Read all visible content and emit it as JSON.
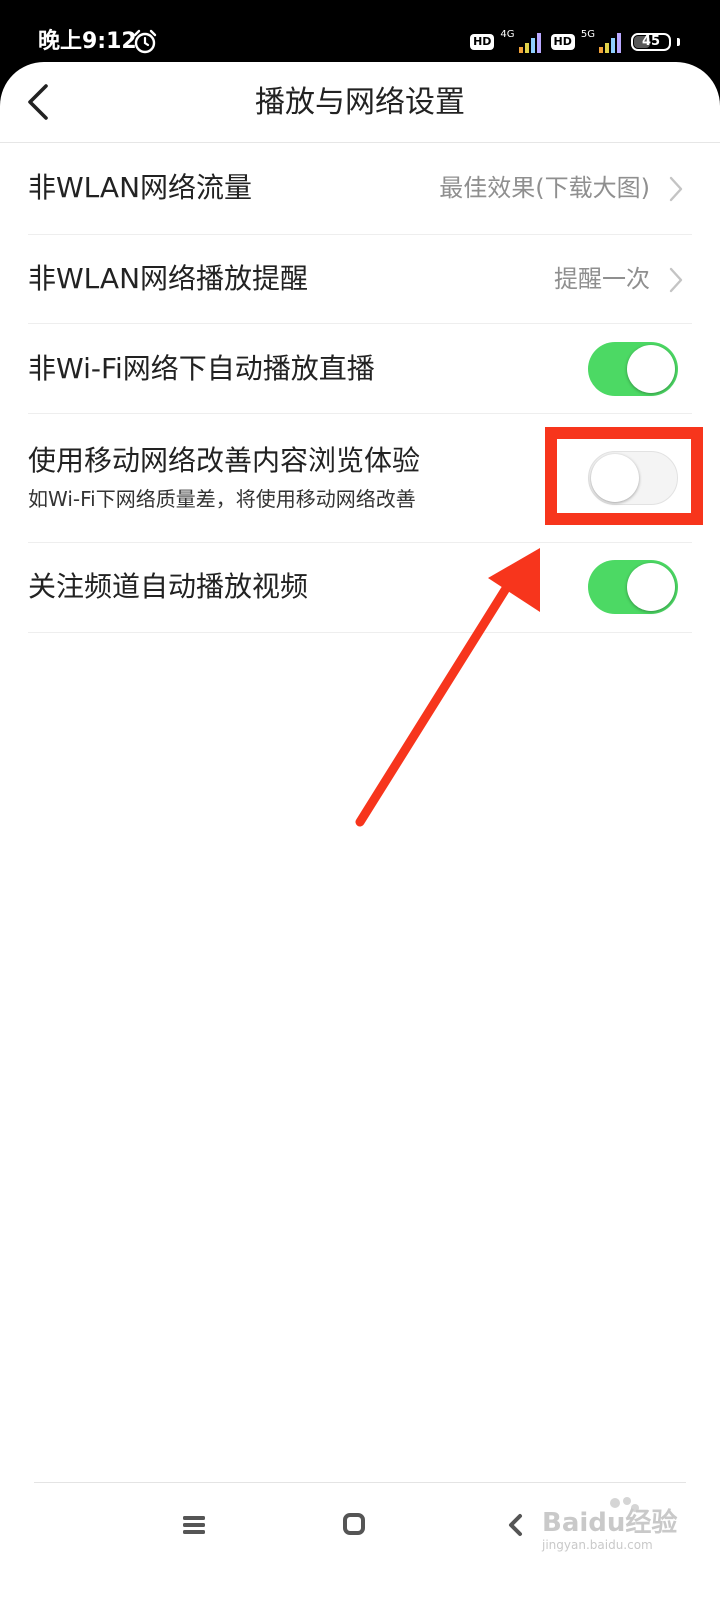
{
  "status_bar": {
    "time": "晚上9:12",
    "hd_badges": [
      "HD",
      "HD"
    ],
    "network_types": [
      "4G",
      "5G"
    ],
    "battery": "45",
    "icons": [
      "alarm-icon",
      "signal-icon",
      "signal-icon",
      "battery-icon"
    ]
  },
  "header": {
    "title": "播放与网络设置",
    "back_icon": "chevron-left-icon"
  },
  "settings": {
    "rows": [
      {
        "label": "非WLAN网络流量",
        "value": "最佳效果(下载大图)",
        "type": "link"
      },
      {
        "label": "非WLAN网络播放提醒",
        "value": "提醒一次",
        "type": "link"
      },
      {
        "label": "非Wi-Fi网络下自动播放直播",
        "type": "toggle",
        "enabled": true
      },
      {
        "label": "使用移动网络改善内容浏览体验",
        "subtitle": "如Wi-Fi下网络质量差，将使用移动网络改善",
        "type": "toggle",
        "enabled": false
      },
      {
        "label": "关注频道自动播放视频",
        "type": "toggle",
        "enabled": true
      }
    ]
  },
  "colors": {
    "toggle_on": "#4cd964",
    "toggle_off": "#f4f4f4",
    "annotation": "#f7351c"
  },
  "nav_bar": {
    "icons": [
      "menu-icon",
      "home-square-icon",
      "back-chevron-icon"
    ]
  },
  "watermark": {
    "text": "Baidu经验",
    "url": "jingyan.baidu.com"
  }
}
